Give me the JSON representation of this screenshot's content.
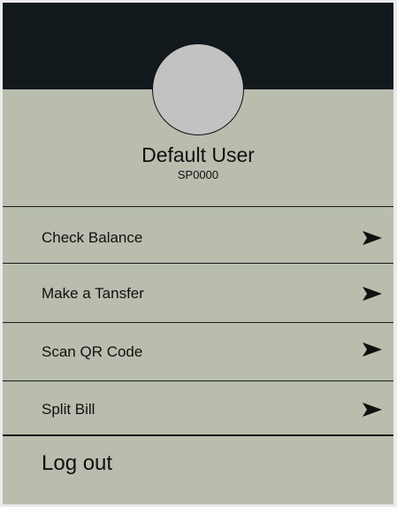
{
  "profile": {
    "name": "Default User",
    "id": "SP0000"
  },
  "menu": {
    "items": [
      {
        "label": "Check Balance",
        "icon": "arrow-right-icon"
      },
      {
        "label": "Make a Tansfer",
        "icon": "arrow-right-icon"
      },
      {
        "label": "Scan QR Code",
        "icon": "arrow-right-icon"
      },
      {
        "label": "Split Bill",
        "icon": "arrow-right-icon"
      }
    ]
  },
  "logout": {
    "label": "Log out"
  },
  "colors": {
    "header": "#11191d",
    "panel": "#b8bdad",
    "avatar": "#c2c2c2"
  }
}
